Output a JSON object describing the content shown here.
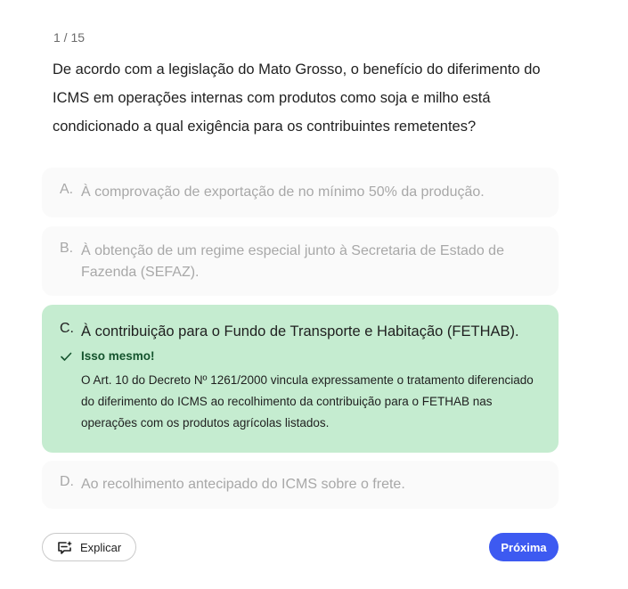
{
  "quiz": {
    "counter": "1 / 15",
    "question": "De acordo com a legislação do Mato Grosso, o benefício do diferimento do ICMS em operações internas com produtos como soja e milho está condicionado a qual exigência para os contribuintes remetentes?",
    "options": [
      {
        "letter": "A.",
        "text": "À comprovação de exportação de no mínimo 50% da produção."
      },
      {
        "letter": "B.",
        "text": "À obtenção de um regime especial junto à Secretaria de Estado de Fazenda (SEFAZ)."
      },
      {
        "letter": "C.",
        "text": "À contribuição para o Fundo de Transporte e Habitação (FETHAB)."
      },
      {
        "letter": "D.",
        "text": "Ao recolhimento antecipado do ICMS sobre o frete."
      }
    ],
    "feedback": {
      "title": "Isso mesmo!",
      "body": "O Art. 10 do Decreto Nº 1261/2000 vincula expressamente o tratamento diferenciado do diferimento do ICMS ao recolhimento da contribuição para o FETHAB nas operações com os produtos agrícolas listados."
    }
  },
  "actions": {
    "explain_label": "Explicar",
    "next_label": "Próxima"
  },
  "colors": {
    "correct_bg": "#c5ecd0",
    "primary": "#3d5af1"
  },
  "icons": {
    "check": "check-icon",
    "explain": "sparkle-comment-icon"
  }
}
